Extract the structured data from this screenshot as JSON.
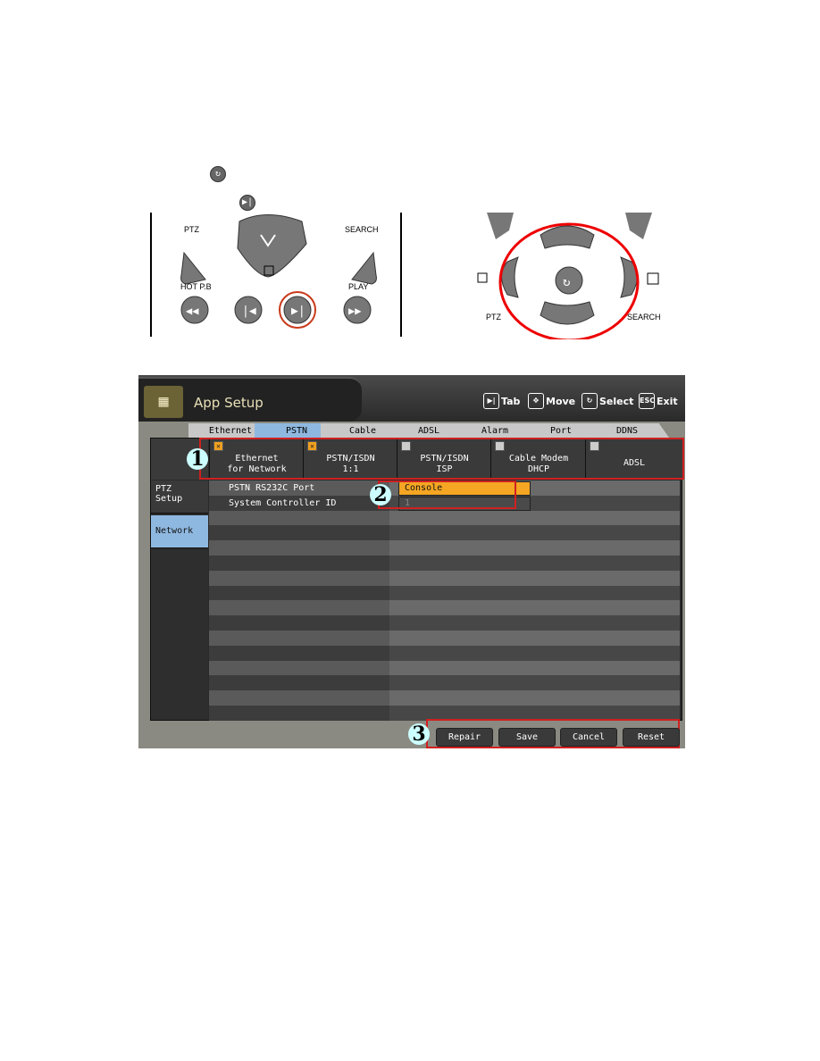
{
  "remote": {
    "left": {
      "labels": {
        "ptz": "PTZ",
        "search": "SEARCH",
        "hot_pb": "HOT P.B",
        "play": "PLAY"
      }
    },
    "right": {
      "labels": {
        "ptz": "PTZ",
        "search": "SEARCH"
      }
    },
    "highlight_color": "#d02020"
  },
  "header": {
    "title": "App Setup",
    "hints": [
      {
        "key": "▶|",
        "label": "Tab"
      },
      {
        "key": "✥",
        "label": "Move"
      },
      {
        "key": "↻",
        "label": "Select"
      },
      {
        "key": "ESC",
        "label": "Exit"
      }
    ]
  },
  "tabs": [
    "Ethernet",
    "PSTN",
    "Cable",
    "ADSL",
    "Alarm",
    "Port",
    "DDNS"
  ],
  "active_tab": "PSTN",
  "options": [
    {
      "line1": "Ethernet",
      "line2": "for Network",
      "checked": true
    },
    {
      "line1": "PSTN/ISDN",
      "line2": "1:1",
      "checked": true
    },
    {
      "line1": "PSTN/ISDN",
      "line2": "ISP",
      "checked": false
    },
    {
      "line1": "Cable Modem",
      "line2": "DHCP",
      "checked": false
    },
    {
      "line1": "ADSL",
      "line2": "",
      "checked": false
    }
  ],
  "sidebar": [
    {
      "label": "PTZ Setup"
    },
    {
      "label": "Network"
    }
  ],
  "fields": [
    {
      "label": "PSTN RS232C Port",
      "value": "Console"
    },
    {
      "label": "System Controller ID",
      "value": "1"
    }
  ],
  "buttons": {
    "repair": "Repair",
    "save": "Save",
    "cancel": "Cancel",
    "reset": "Reset"
  },
  "callouts": [
    "1",
    "2",
    "3"
  ]
}
